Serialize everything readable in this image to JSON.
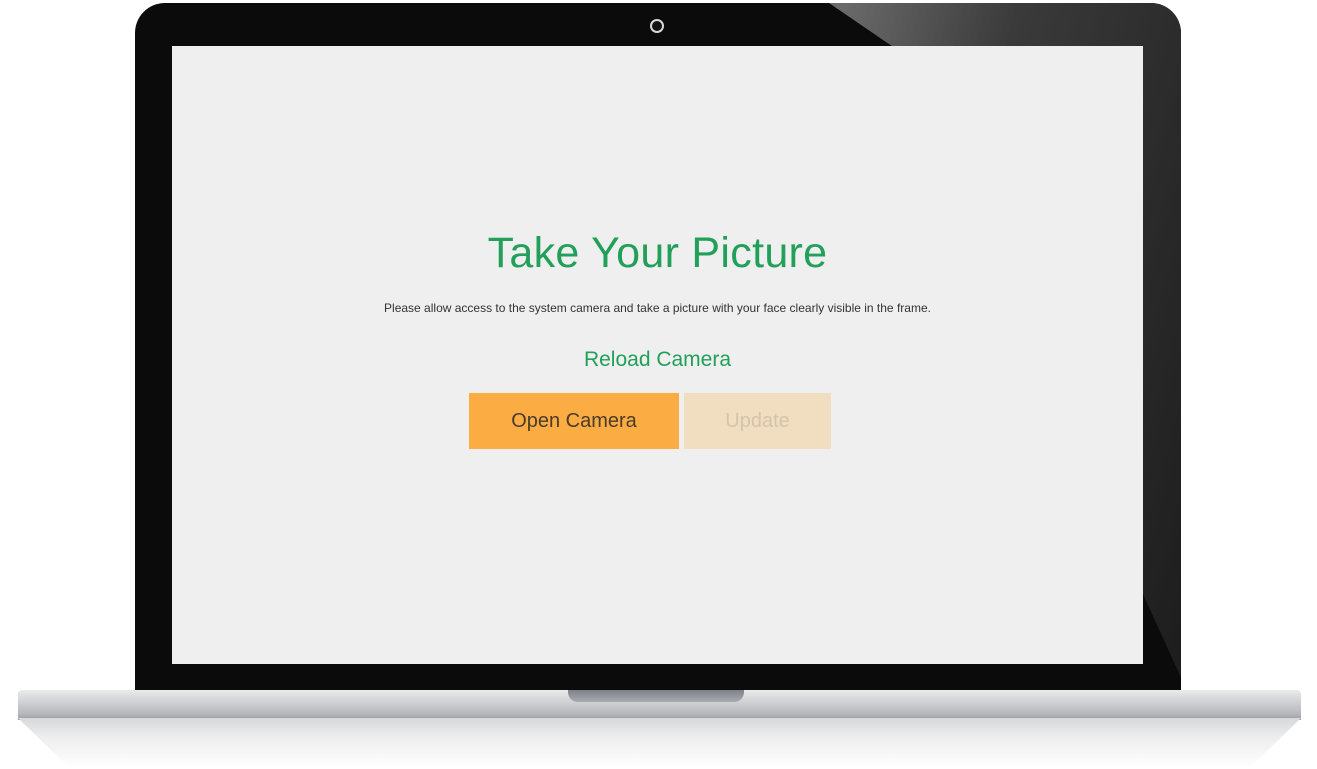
{
  "screen": {
    "title": "Take Your Picture",
    "subtitle": "Please allow access to the system camera and take a picture with your face clearly visible in the frame.",
    "reload_label": "Reload Camera",
    "open_camera_label": "Open Camera",
    "update_label": "Update"
  },
  "colors": {
    "accent_green": "#22a05a",
    "button_orange": "#fbac42",
    "button_disabled": "#f1dec0",
    "screen_bg": "#eeefee"
  }
}
